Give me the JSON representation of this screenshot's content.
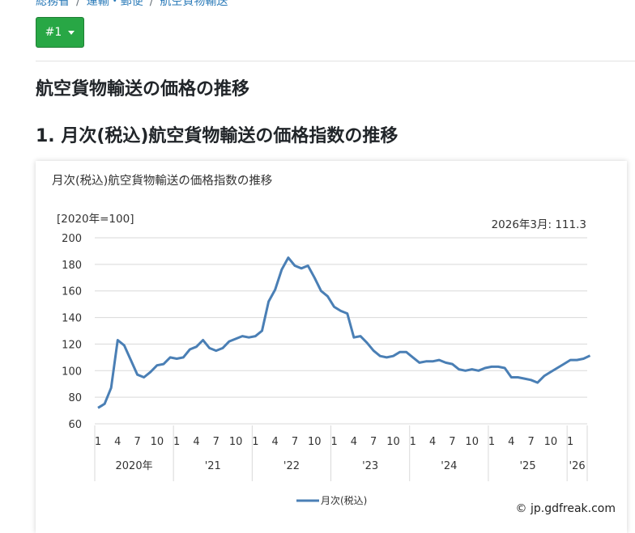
{
  "breadcrumb": {
    "items": [
      "総務省",
      "運輸・郵便",
      "航空貨物輸送"
    ]
  },
  "dropdown": {
    "label": "#1"
  },
  "page_title": "航空貨物輸送の価格の推移",
  "section_title": "1. 月次(税込)航空貨物輸送の価格指数の推移",
  "colors": {
    "line": "#4a7fb5",
    "grid": "#d9d9d9",
    "button": "#28a745"
  },
  "chart_data": {
    "type": "line",
    "title": "月次(税込)航空貨物輸送の価格指数の推移",
    "unit_label": "[2020年=100]",
    "latest_label": "2026年3月: 111.3",
    "ylim": [
      60,
      200
    ],
    "y_ticks": [
      60,
      80,
      100,
      120,
      140,
      160,
      180,
      200
    ],
    "x_tick_labels": [
      "1",
      "4",
      "7",
      "10",
      "1",
      "4",
      "7",
      "10",
      "1",
      "4",
      "7",
      "10",
      "1",
      "4",
      "7",
      "10",
      "1",
      "4",
      "7",
      "10",
      "1",
      "4",
      "7",
      "10",
      "1"
    ],
    "year_labels": [
      "2020年",
      "'21",
      "'22",
      "'23",
      "'24",
      "'25",
      "'26"
    ],
    "grid": true,
    "legend_position": "bottom",
    "credit": "© jp.gdfreak.com",
    "series": [
      {
        "name": "月次(税込)",
        "start": "2020-01",
        "values": [
          72,
          75,
          87,
          123,
          119,
          108,
          97,
          95,
          99,
          104,
          105,
          110,
          109,
          110,
          116,
          118,
          123,
          117,
          115,
          117,
          122,
          124,
          126,
          125,
          126,
          130,
          152,
          161,
          176,
          185,
          179,
          177,
          179,
          170,
          160,
          156,
          148,
          145,
          143,
          125,
          126,
          121,
          115,
          111,
          110,
          111,
          114,
          114,
          110,
          106,
          107,
          107,
          108,
          106,
          105,
          101,
          100,
          101,
          100,
          102,
          103,
          103,
          102,
          95,
          95,
          94,
          93,
          91,
          96,
          99,
          102,
          105,
          108,
          108,
          109,
          111.3
        ]
      }
    ]
  }
}
